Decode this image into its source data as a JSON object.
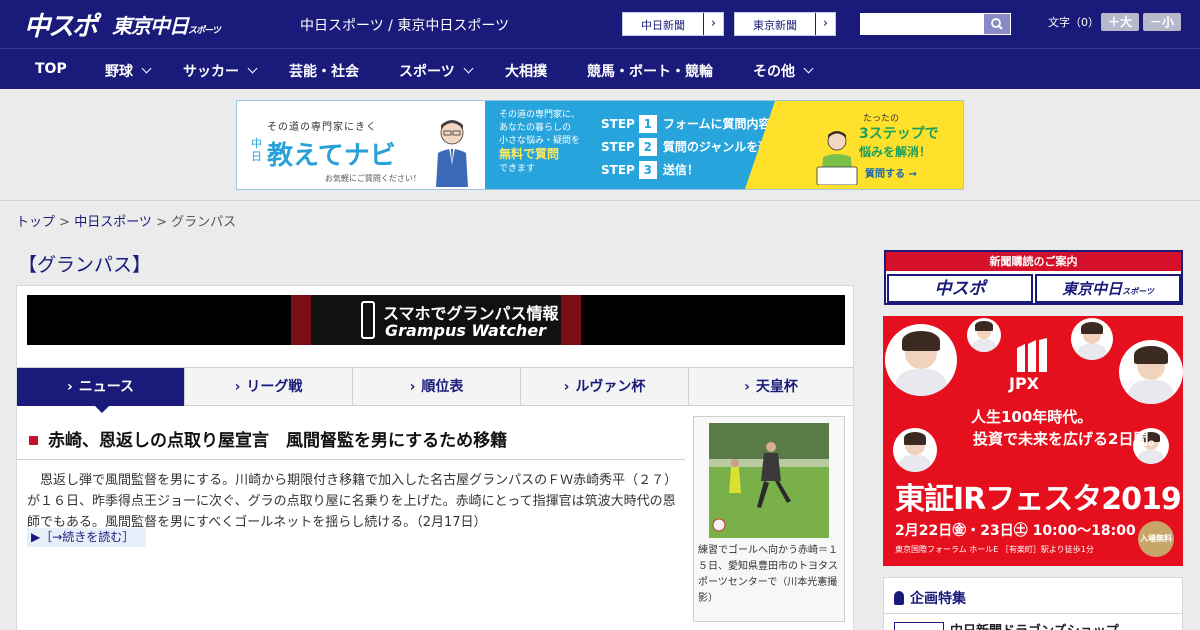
{
  "header": {
    "logo_primary": "中スポ",
    "logo_secondary": "東京中日",
    "logo_secondary_suffix": "スポーツ",
    "site_title": "中日スポーツ / 東京中日スポーツ",
    "links": [
      {
        "label": "中日新聞",
        "arrow": "›"
      },
      {
        "label": "東京新聞",
        "arrow": "›"
      }
    ],
    "search_value": "",
    "font_size_label": "文字（0）",
    "font_bigger": "＋大",
    "font_smaller": "－小"
  },
  "nav": {
    "items": [
      {
        "label": "TOP",
        "dropdown": false
      },
      {
        "label": "野球",
        "dropdown": true
      },
      {
        "label": "サッカー",
        "dropdown": true
      },
      {
        "label": "芸能・社会",
        "dropdown": false
      },
      {
        "label": "スポーツ",
        "dropdown": true
      },
      {
        "label": "大相撲",
        "dropdown": false
      },
      {
        "label": "競馬・ボート・競輪",
        "dropdown": false
      },
      {
        "label": "その他",
        "dropdown": true
      }
    ]
  },
  "ad_banner": {
    "tagline": "その道の専門家にきく",
    "brand_prefix": "中日",
    "brand": "教えてナビ",
    "footnote": "お気軽にご質問ください！",
    "copy_line1": "その道の専門家に、",
    "copy_line2": "あなたの暮らしの",
    "copy_line3": "小さな悩み・疑問を",
    "copy_highlight": "無料で質問",
    "copy_line4": "できます",
    "steps": [
      {
        "label": "STEP",
        "num": "1",
        "text": "フォームに質問内容を入力"
      },
      {
        "label": "STEP",
        "num": "2",
        "text": "質問のジャンルを選択"
      },
      {
        "label": "STEP",
        "num": "3",
        "text": "送信！"
      }
    ],
    "right_l1": "たったの",
    "right_l2": "3ステップで",
    "right_l3": "悩みを解消！",
    "cta": "質問する →"
  },
  "breadcrumb": {
    "home": "トップ",
    "sep1": " > ",
    "section": "中日スポーツ",
    "sep2": " > ",
    "current": "グランパス"
  },
  "main": {
    "heading": "【グランパス】",
    "promo_line1": "スマホでグランパス情報",
    "promo_line2": "Grampus Watcher",
    "tabs": [
      {
        "label": "ニュース",
        "active": true
      },
      {
        "label": "リーグ戦",
        "active": false
      },
      {
        "label": "順位表",
        "active": false
      },
      {
        "label": "ルヴァン杯",
        "active": false
      },
      {
        "label": "天皇杯",
        "active": false
      }
    ],
    "tab_marker": "›",
    "article": {
      "title": "赤崎、恩返しの点取り屋宣言　風間督監を男にするため移籍",
      "body": "　恩返し弾で風間監督を男にする。川崎から期限付き移籍で加入した名古屋グランパスのＦＷ赤崎秀平（２７）が１６日、昨季得点王ジョーに次ぐ、グラの点取り屋に名乗りを上げた。赤崎にとって指揮官は筑波大時代の恩師でもある。風間監督を男にすべくゴールネットを揺らし続ける。（2月17日）",
      "read_more": "▶［→続きを読む］",
      "photo_caption": "練習でゴールへ向かう赤崎＝１５日、愛知県豊田市のトヨタスポーツセンターで（川本光憲撮影）"
    }
  },
  "sidebar": {
    "subscribe_head": "新聞購読のご案内",
    "subscribe_btn1": "中スポ",
    "subscribe_btn2": "東京中日",
    "subscribe_btn2_suffix": "スポーツ",
    "jpx_ad": {
      "name": "JPX",
      "line1": "人生100年時代。",
      "line2": "投資で未来を広げる2日間。",
      "event": "東証IRフェスタ2019",
      "date": "2月22日㊎・23日㊏ 10:00～18:00",
      "venue": "東京国際フォーラム ホールE ［有楽町］駅より徒歩1分",
      "free": "入場無料"
    },
    "feature_head": "企画特集",
    "feature_item": "中日新聞ドラゴンズショップ"
  },
  "colors": {
    "brand_navy": "#1a1a7a",
    "accent_red": "#c4102a",
    "ad_blue": "#27a4dc",
    "ad_yellow": "#ffe02a",
    "jpx_red": "#e60f1e"
  }
}
